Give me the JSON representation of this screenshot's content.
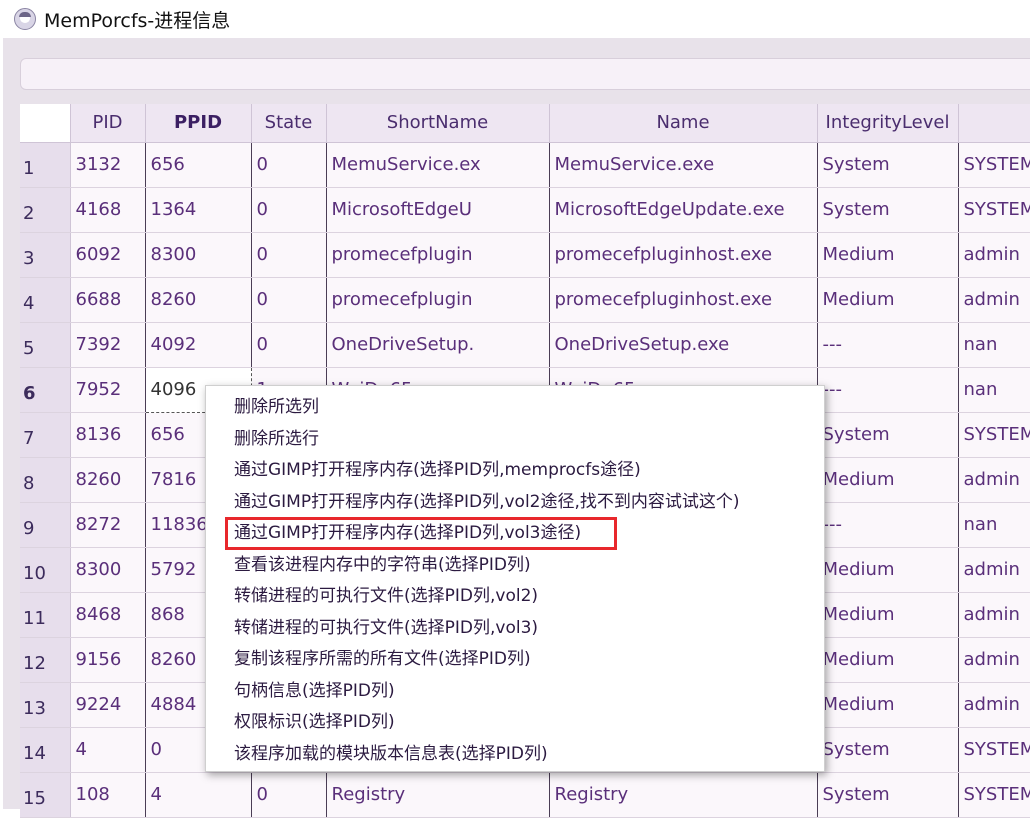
{
  "window": {
    "title": "MemPorcfs-进程信息"
  },
  "table": {
    "headers": [
      "PID",
      "PPID",
      "State",
      "ShortName",
      "Name",
      "IntegrityLevel",
      ""
    ],
    "rows": [
      {
        "n": "1",
        "pid": "3132",
        "ppid": "656",
        "state": "0",
        "short": "MemuService.ex",
        "name": "MemuService.exe",
        "integ": "System",
        "user": "SYSTEM"
      },
      {
        "n": "2",
        "pid": "4168",
        "ppid": "1364",
        "state": "0",
        "short": "MicrosoftEdgeU",
        "name": "MicrosoftEdgeUpdate.exe",
        "integ": "System",
        "user": "SYSTEM"
      },
      {
        "n": "3",
        "pid": "6092",
        "ppid": "8300",
        "state": "0",
        "short": "promecefplugin",
        "name": "promecefpluginhost.exe",
        "integ": "Medium",
        "user": "admin"
      },
      {
        "n": "4",
        "pid": "6688",
        "ppid": "8260",
        "state": "0",
        "short": "promecefplugin",
        "name": "promecefpluginhost.exe",
        "integ": "Medium",
        "user": "admin"
      },
      {
        "n": "5",
        "pid": "7392",
        "ppid": "4092",
        "state": "0",
        "short": "OneDriveSetup.",
        "name": "OneDriveSetup.exe",
        "integ": "---",
        "user": "nan"
      },
      {
        "n": "6",
        "pid": "7952",
        "ppid": "4096",
        "state": "1",
        "short": "WeiDu65",
        "name": "WeiDu65",
        "integ": "---",
        "user": "nan"
      },
      {
        "n": "7",
        "pid": "8136",
        "ppid": "656",
        "state": "",
        "short": "",
        "name": "",
        "integ": "System",
        "user": "SYSTEM"
      },
      {
        "n": "8",
        "pid": "8260",
        "ppid": "7816",
        "state": "",
        "short": "",
        "name": "",
        "integ": "Medium",
        "user": "admin"
      },
      {
        "n": "9",
        "pid": "8272",
        "ppid": "11836",
        "state": "",
        "short": "",
        "name": "",
        "integ": "---",
        "user": "nan"
      },
      {
        "n": "10",
        "pid": "8300",
        "ppid": "5792",
        "state": "",
        "short": "",
        "name": "",
        "integ": "Medium",
        "user": "admin"
      },
      {
        "n": "11",
        "pid": "8468",
        "ppid": "868",
        "state": "",
        "short": "",
        "name": "",
        "integ": "Medium",
        "user": "admin"
      },
      {
        "n": "12",
        "pid": "9156",
        "ppid": "8260",
        "state": "",
        "short": "",
        "name": "",
        "integ": "Medium",
        "user": "admin"
      },
      {
        "n": "13",
        "pid": "9224",
        "ppid": "4884",
        "state": "",
        "short": "",
        "name": "",
        "integ": "Medium",
        "user": "admin"
      },
      {
        "n": "14",
        "pid": "4",
        "ppid": "0",
        "state": "",
        "short": "",
        "name": "",
        "integ": "System",
        "user": "SYSTEM"
      },
      {
        "n": "15",
        "pid": "108",
        "ppid": "4",
        "state": "0",
        "short": "Registry",
        "name": "Registry",
        "integ": "System",
        "user": "SYSTEM"
      }
    ]
  },
  "context_menu": {
    "items": [
      "删除所选列",
      "删除所选行",
      "通过GIMP打开程序内存(选择PID列,memprocfs途径)",
      "通过GIMP打开程序内存(选择PID列,vol2途径,找不到内容试试这个)",
      "通过GIMP打开程序内存(选择PID列,vol3途径)",
      "查看该进程内存中的字符串(选择PID列)",
      "转储进程的可执行文件(选择PID列,vol2)",
      "转储进程的可执行文件(选择PID列,vol3)",
      "复制该程序所需的所有文件(选择PID列)",
      "句柄信息(选择PID列)",
      "权限标识(选择PID列)",
      "该程序加载的模块版本信息表(选择PID列)"
    ],
    "highlighted_index": 4,
    "highlight_color": "#e8282c"
  }
}
